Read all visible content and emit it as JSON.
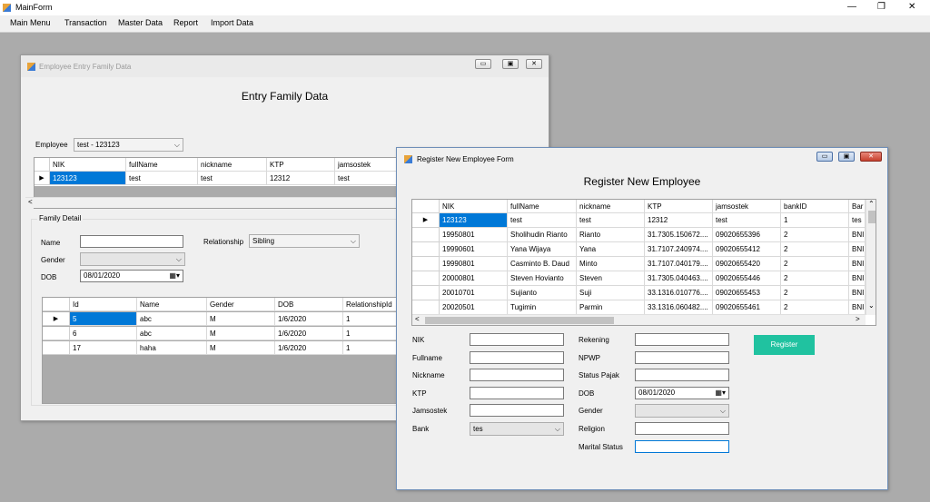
{
  "app": {
    "title": "MainForm",
    "minimize": "—",
    "maximize": "❐",
    "close": "✕"
  },
  "menu": [
    "Main Menu",
    "Transaction",
    "Master Data",
    "Report",
    "Import Data"
  ],
  "family_window": {
    "title": "Employee Entry Family Data",
    "heading": "Entry Family Data",
    "employee_label": "Employee",
    "employee_value": "test - 123123",
    "columns": [
      "NIK",
      "fullName",
      "nickname",
      "KTP",
      "jamsostek"
    ],
    "rows": [
      [
        "123123",
        "test",
        "test",
        "12312",
        "test"
      ]
    ],
    "group_label": "Family Detail",
    "name_label": "Name",
    "name_value": "",
    "gender_label": "Gender",
    "gender_value": "",
    "dob_label": "DOB",
    "dob_value": "08/01/2020",
    "relationship_label": "Relationship",
    "relationship_value": "Sibling",
    "detail_columns": [
      "Id",
      "Name",
      "Gender",
      "DOB",
      "RelationshipId"
    ],
    "detail_rows": [
      [
        "5",
        "abc",
        "M",
        "1/6/2020",
        "1"
      ],
      [
        "6",
        "abc",
        "M",
        "1/6/2020",
        "1"
      ],
      [
        "17",
        "haha",
        "M",
        "1/6/2020",
        "1"
      ]
    ]
  },
  "register_window": {
    "title": "Register New Employee Form",
    "heading": "Register New Employee",
    "columns": [
      "NIK",
      "fullName",
      "nickname",
      "KTP",
      "jamsostek",
      "bankID",
      "Bar"
    ],
    "rows": [
      [
        "123123",
        "test",
        "test",
        "12312",
        "test",
        "1",
        "tes"
      ],
      [
        "19950801",
        "Sholihudin Rianto",
        "Rianto",
        "31.7305.150672....",
        "09020655396",
        "2",
        "BNI"
      ],
      [
        "19990601",
        "Yana Wijaya",
        "Yana",
        "31.7107.240974....",
        "09020655412",
        "2",
        "BNI"
      ],
      [
        "19990801",
        "Casminto B. Daud",
        "Minto",
        "31.7107.040179....",
        "09020655420",
        "2",
        "BNI"
      ],
      [
        "20000801",
        "Steven Hovianto",
        "Steven",
        "31.7305.040463....",
        "09020655446",
        "2",
        "BNI"
      ],
      [
        "20010701",
        "Sujianto",
        "Suji",
        "33.1316.010776....",
        "09020655453",
        "2",
        "BNI"
      ],
      [
        "20020501",
        "Tugimin",
        "Parmin",
        "33.1316.060482....",
        "09020655461",
        "2",
        "BNI"
      ]
    ],
    "fields_left": [
      {
        "label": "NIK",
        "value": ""
      },
      {
        "label": "Fullname",
        "value": ""
      },
      {
        "label": "Nickname",
        "value": ""
      },
      {
        "label": "KTP",
        "value": ""
      },
      {
        "label": "Jamsostek",
        "value": ""
      },
      {
        "label": "Bank",
        "value": "tes"
      }
    ],
    "fields_right": [
      {
        "label": "Rekening",
        "value": ""
      },
      {
        "label": "NPWP",
        "value": ""
      },
      {
        "label": "Status Pajak",
        "value": ""
      },
      {
        "label": "DOB",
        "value": "08/01/2020"
      },
      {
        "label": "Gender",
        "value": ""
      },
      {
        "label": "Religion",
        "value": ""
      },
      {
        "label": "Marital Status",
        "value": ""
      }
    ],
    "register_button": "Register",
    "button_color": "#20c2a0"
  }
}
